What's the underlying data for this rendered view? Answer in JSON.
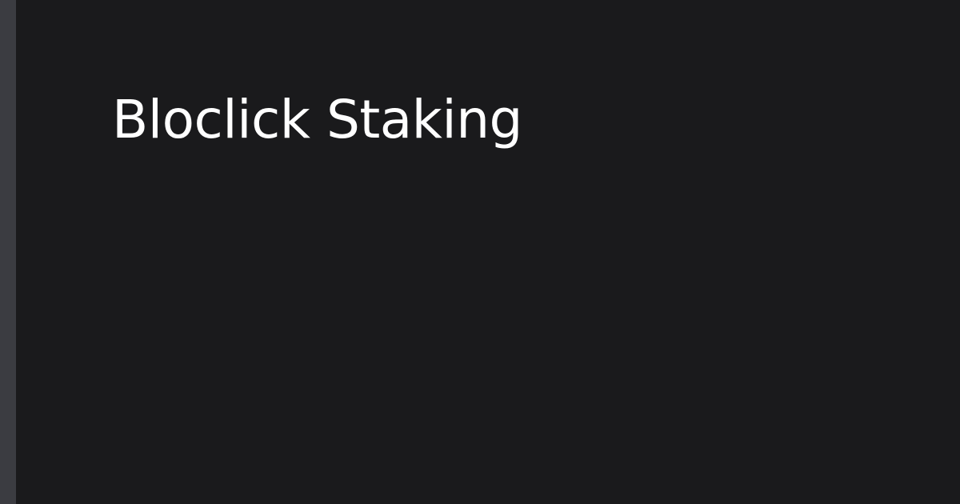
{
  "card": {
    "title": "Bloclick Staking"
  },
  "colors": {
    "background": "#1a1a1c",
    "accent_bar": "#3b3c41",
    "title_text": "#ffffff"
  }
}
